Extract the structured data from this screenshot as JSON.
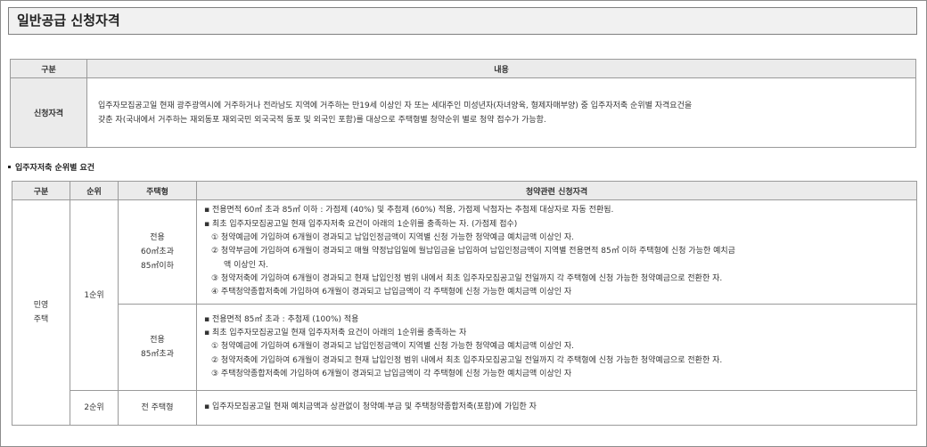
{
  "title": "일반공급 신청자격",
  "qual_table": {
    "headers": [
      "구분",
      "내용"
    ],
    "row_label": "신청자격",
    "content_lines": [
      "입주자모집공고일 현재 광주광역시에 거주하거나 전라남도 지역에 거주하는 만19세 이상인 자 또는 세대주인 미성년자(자녀양육, 형제자매부양) 중 입주자저축 순위별 자격요건을",
      "갖춘 자(국내에서 거주하는 재외동포 재외국민 외국국적 동포 및 외국인 포함)를 대상으로 주택형별 청약순위 별로 청약 접수가 가능함."
    ]
  },
  "section_title": "입주자저축 순위별 요건",
  "rank_table": {
    "headers": [
      "구분",
      "순위",
      "주택형",
      "청약관련 신청자격"
    ],
    "category": "민영\n주택",
    "rank1": "1순위",
    "rank2": "2순위",
    "type_a": "전용\n60㎡초과\n85㎡이하",
    "type_b": "전용\n85㎡초과",
    "type_c": "전 주택형",
    "req_a": [
      "▪ 전용면적 60㎡ 초과 85㎡ 이하 : 가점제 (40%) 및 추첨제 (60%) 적용, 가점제 낙첨자는 추첨제 대상자로 자동 전환됨.",
      "▪ 최초 입주자모집공고일 현재 입주자저축 요건이 아래의 1순위를 충족하는 자. (가점제 접수)",
      "① 청약예금에 가입하여 6개월이 경과되고 납입인정금액이 지역별 신청 가능한 청약예금 예치금액 이상인 자.",
      "② 청약부금에 가입하여 6개월이 경과되고 매월 약정납입일에 월납입금을 납입하여 납입인정금액이 지역별 전용면적 85㎡ 이하 주택형에 신청 가능한 예치금",
      "액 이상인 자.",
      "③ 청약저축에 가입하여 6개월이 경과되고 현재 납입인정 범위 내에서 최초 입주자모집공고일 전일까지 각 주택형에 신청 가능한 청약예금으로 전환한 자.",
      "④ 주택청약종합저축에 가입하여 6개월이 경과되고 납입금액이 각 주택형에 신청 가능한 예치금액 이상인 자"
    ],
    "req_b": [
      "▪ 전용면적 85㎡ 초과 : 추첨제 (100%) 적용",
      "▪ 최초 입주자모집공고일 현재 입주자저축 요건이 아래의 1순위를 충족하는 자",
      "① 청약예금에 가입하여 6개월이 경과되고 납입인정금액이 지역별 신청 가능한 청약예금 예치금액 이상인 자.",
      "② 청약저축에 가입하여 6개월이 경과되고 현재 납입인정 범위 내에서 최초 입주자모집공고일 전일까지 각 주택형에 신청 가능한 청약예금으로 전환한 자.",
      "③ 주택청약종합저축에 가입하여 6개월이 경과되고 납입금액이 각 주택형에 신청 가능한 예치금액 이상인 자"
    ],
    "req_c": "▪ 입주자모집공고일 현재 예치금액과 상관없이 청약예·부금 및 주택청약종합저축(포함)에 가입한 자"
  }
}
